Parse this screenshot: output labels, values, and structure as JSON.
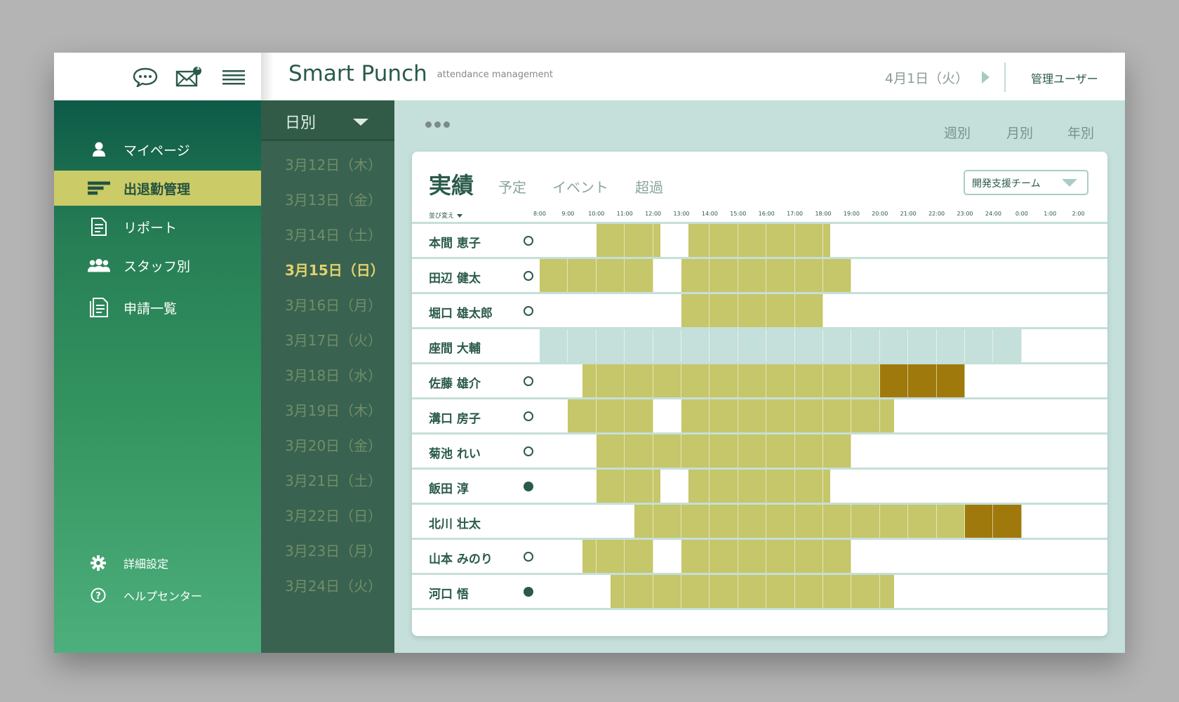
{
  "topbar": {
    "title": "Smart Punch",
    "subtitle": "attendance management",
    "date": "4月1日（火）",
    "user": "管理ユーザー",
    "mail_badge": "1"
  },
  "sidebar": {
    "items": [
      {
        "label": "マイページ",
        "icon": "user-icon"
      },
      {
        "label": "出退勤管理",
        "icon": "bars-icon",
        "active": true
      },
      {
        "label": "リポート",
        "icon": "document-icon"
      },
      {
        "label": "スタッフ別",
        "icon": "group-icon"
      },
      {
        "label": "申請一覧",
        "icon": "forms-icon"
      }
    ],
    "footer": [
      {
        "label": "詳細設定",
        "icon": "gear-icon"
      },
      {
        "label": "ヘルプセンター",
        "icon": "help-icon"
      }
    ]
  },
  "date_panel": {
    "view_label": "日別",
    "dates": [
      "3月12日（木）",
      "3月13日（金）",
      "3月14日（土）",
      "3月15日（日）",
      "3月16日（月）",
      "3月17日（火）",
      "3月18日（水）",
      "3月19日（木）",
      "3月20日（金）",
      "3月21日（土）",
      "3月22日（日）",
      "3月23日（月）",
      "3月24日（火）"
    ],
    "active_index": 3
  },
  "period_tabs": [
    "週別",
    "月別",
    "年別"
  ],
  "card": {
    "tabs": [
      "実績",
      "予定",
      "イベント",
      "超過"
    ],
    "team": "開発支援チーム",
    "sort_label": "並び変え",
    "hours": [
      "8:00",
      "9:00",
      "10:00",
      "11:00",
      "12:00",
      "13:00",
      "14:00",
      "15:00",
      "16:00",
      "17:00",
      "18:00",
      "19:00",
      "20:00",
      "21:00",
      "22:00",
      "23:00",
      "24:00",
      "0:00",
      "1:00",
      "2:00"
    ]
  },
  "colors": {
    "work": "#c6c66a",
    "overtime": "#a0790c",
    "absent": "#c5dfda",
    "accent": "#cbcb68",
    "brand": "#2a5a4a"
  },
  "staff": [
    {
      "name": "本間 恵子",
      "status": "outline",
      "segments": [
        {
          "from": 10,
          "to": 12.25,
          "kind": "work"
        },
        {
          "from": 13.25,
          "to": 18.25,
          "kind": "work"
        }
      ]
    },
    {
      "name": "田辺 健太",
      "status": "outline",
      "segments": [
        {
          "from": 8,
          "to": 12,
          "kind": "work"
        },
        {
          "from": 13,
          "to": 19,
          "kind": "work"
        }
      ]
    },
    {
      "name": "堀口 雄太郎",
      "status": "outline",
      "segments": [
        {
          "from": 13,
          "to": 18,
          "kind": "work"
        }
      ]
    },
    {
      "name": "座間 大輔",
      "status": "none",
      "segments": [
        {
          "from": 8,
          "to": 25,
          "kind": "absent"
        }
      ]
    },
    {
      "name": "佐藤 雄介",
      "status": "outline",
      "segments": [
        {
          "from": 9.5,
          "to": 20,
          "kind": "work"
        },
        {
          "from": 20,
          "to": 23,
          "kind": "overtime"
        }
      ]
    },
    {
      "name": "溝口 房子",
      "status": "outline",
      "segments": [
        {
          "from": 9,
          "to": 12,
          "kind": "work"
        },
        {
          "from": 13,
          "to": 20.5,
          "kind": "work"
        }
      ]
    },
    {
      "name": "菊池 れい",
      "status": "outline",
      "segments": [
        {
          "from": 10,
          "to": 19,
          "kind": "work"
        }
      ]
    },
    {
      "name": "飯田 淳",
      "status": "filled",
      "segments": [
        {
          "from": 10,
          "to": 12.25,
          "kind": "work"
        },
        {
          "from": 13.25,
          "to": 18.25,
          "kind": "work"
        }
      ]
    },
    {
      "name": "北川 壮太",
      "status": "none",
      "segments": [
        {
          "from": 11.33,
          "to": 23,
          "kind": "work"
        },
        {
          "from": 23,
          "to": 25,
          "kind": "overtime"
        }
      ]
    },
    {
      "name": "山本 みのり",
      "status": "outline",
      "segments": [
        {
          "from": 9.5,
          "to": 12,
          "kind": "work"
        },
        {
          "from": 13,
          "to": 19,
          "kind": "work"
        }
      ]
    },
    {
      "name": "河口 悟",
      "status": "filled",
      "segments": [
        {
          "from": 10.5,
          "to": 20.5,
          "kind": "work"
        }
      ]
    }
  ]
}
